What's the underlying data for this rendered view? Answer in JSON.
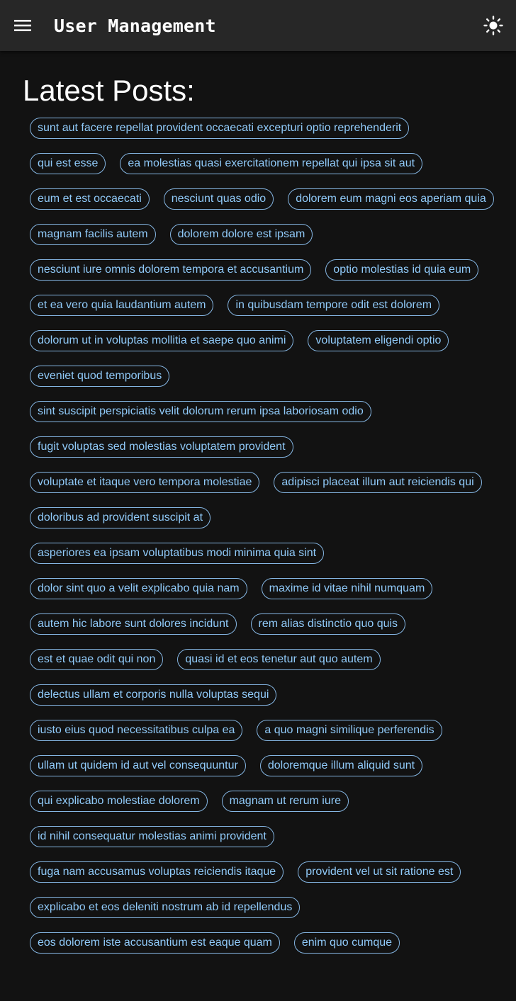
{
  "appbar": {
    "title": "User Management",
    "menu_icon": "hamburger-menu-icon",
    "theme_icon": "sun-icon"
  },
  "main": {
    "heading": "Latest Posts:",
    "posts": [
      "sunt aut facere repellat provident occaecati excepturi optio reprehenderit",
      "qui est esse",
      "ea molestias quasi exercitationem repellat qui ipsa sit aut",
      "eum et est occaecati",
      "nesciunt quas odio",
      "dolorem eum magni eos aperiam quia",
      "magnam facilis autem",
      "dolorem dolore est ipsam",
      "nesciunt iure omnis dolorem tempora et accusantium",
      "optio molestias id quia eum",
      "et ea vero quia laudantium autem",
      "in quibusdam tempore odit est dolorem",
      "dolorum ut in voluptas mollitia et saepe quo animi",
      "voluptatem eligendi optio",
      "eveniet quod temporibus",
      "sint suscipit perspiciatis velit dolorum rerum ipsa laboriosam odio",
      "fugit voluptas sed molestias voluptatem provident",
      "voluptate et itaque vero tempora molestiae",
      "adipisci placeat illum aut reiciendis qui",
      "doloribus ad provident suscipit at",
      "asperiores ea ipsam voluptatibus modi minima quia sint",
      "dolor sint quo a velit explicabo quia nam",
      "maxime id vitae nihil numquam",
      "autem hic labore sunt dolores incidunt",
      "rem alias distinctio quo quis",
      "est et quae odit qui non",
      "quasi id et eos tenetur aut quo autem",
      "delectus ullam et corporis nulla voluptas sequi",
      "iusto eius quod necessitatibus culpa ea",
      "a quo magni similique perferendis",
      "ullam ut quidem id aut vel consequuntur",
      "doloremque illum aliquid sunt",
      "qui explicabo molestiae dolorem",
      "magnam ut rerum iure",
      "id nihil consequatur molestias animi provident",
      "fuga nam accusamus voluptas reiciendis itaque",
      "provident vel ut sit ratione est",
      "explicabo et eos deleniti nostrum ab id repellendus",
      "eos dolorem iste accusantium est eaque quam",
      "enim quo cumque"
    ]
  },
  "colors": {
    "background": "#121212",
    "appbar": "#272727",
    "chip_text": "#90caf9",
    "chip_border": "#85b6e3"
  }
}
